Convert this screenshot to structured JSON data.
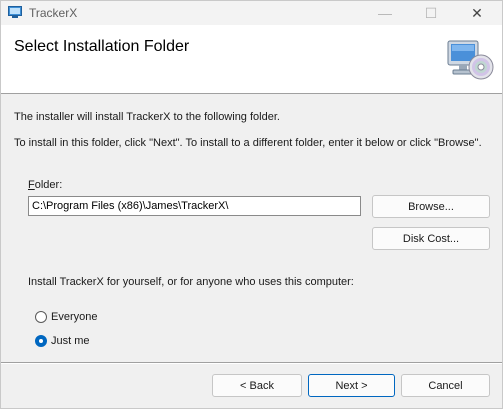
{
  "window": {
    "title": "TrackerX",
    "controls": {
      "minimize": "—",
      "maximize": "☐",
      "close": "✕"
    }
  },
  "header": {
    "title": "Select Installation Folder",
    "graphic": "computer-cd-icon"
  },
  "body": {
    "line1": "The installer will install TrackerX to the following folder.",
    "line2": "To install in this folder, click \"Next\". To install to a different folder, enter it below or click \"Browse\".",
    "folder_label_accel": "F",
    "folder_label_rest": "older:",
    "folder_value": "C:\\Program Files (x86)\\James\\TrackerX\\",
    "browse_label": "Browse...",
    "disk_cost_label": "Disk Cost...",
    "install_for_label": "Install TrackerX for yourself, or for anyone who uses this computer:",
    "options": {
      "everyone": "Everyone",
      "just_me": "Just me",
      "selected": "just_me"
    }
  },
  "footer": {
    "back_label": "< Back",
    "next_label": "Next >",
    "cancel_label": "Cancel"
  },
  "colors": {
    "accent": "#0067c0",
    "background": "#f0f0f0",
    "header_bg": "#ffffff"
  }
}
